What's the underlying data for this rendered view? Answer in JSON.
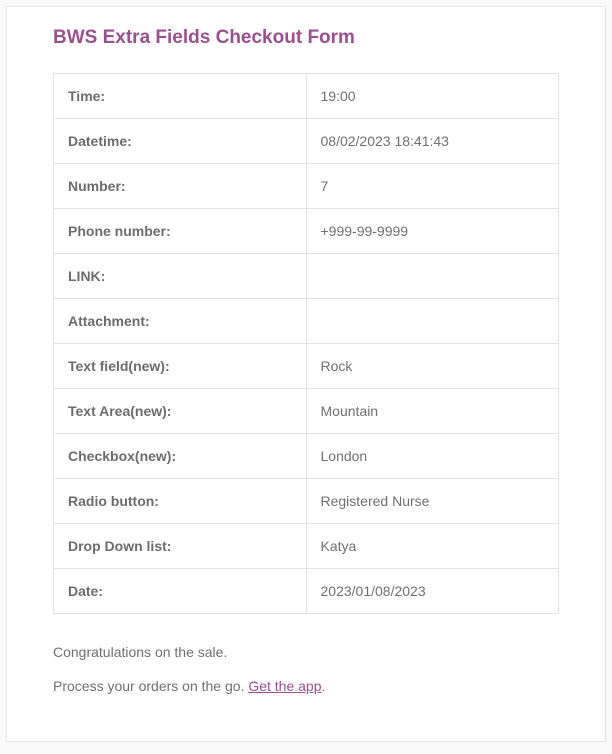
{
  "title": "BWS Extra Fields Checkout Form",
  "rows": [
    {
      "label": "Time:",
      "value": "19:00"
    },
    {
      "label": "Datetime:",
      "value": "08/02/2023 18:41:43"
    },
    {
      "label": "Number:",
      "value": "7"
    },
    {
      "label": "Phone number:",
      "value": "+999-99-9999"
    },
    {
      "label": "LINK:",
      "value": ""
    },
    {
      "label": "Attachment:",
      "value": ""
    },
    {
      "label": "Text field(new):",
      "value": "Rock"
    },
    {
      "label": "Text Area(new):",
      "value": "Mountain"
    },
    {
      "label": "Checkbox(new):",
      "value": "London"
    },
    {
      "label": "Radio button:",
      "value": "Registered Nurse"
    },
    {
      "label": "Drop Down list:",
      "value": "Katya"
    },
    {
      "label": "Date:",
      "value": "2023/01/08/2023"
    }
  ],
  "footer": {
    "congrats": "Congratulations on the sale.",
    "process_prefix": "Process your orders on the go. ",
    "app_link_text": "Get the app",
    "process_suffix": "."
  }
}
